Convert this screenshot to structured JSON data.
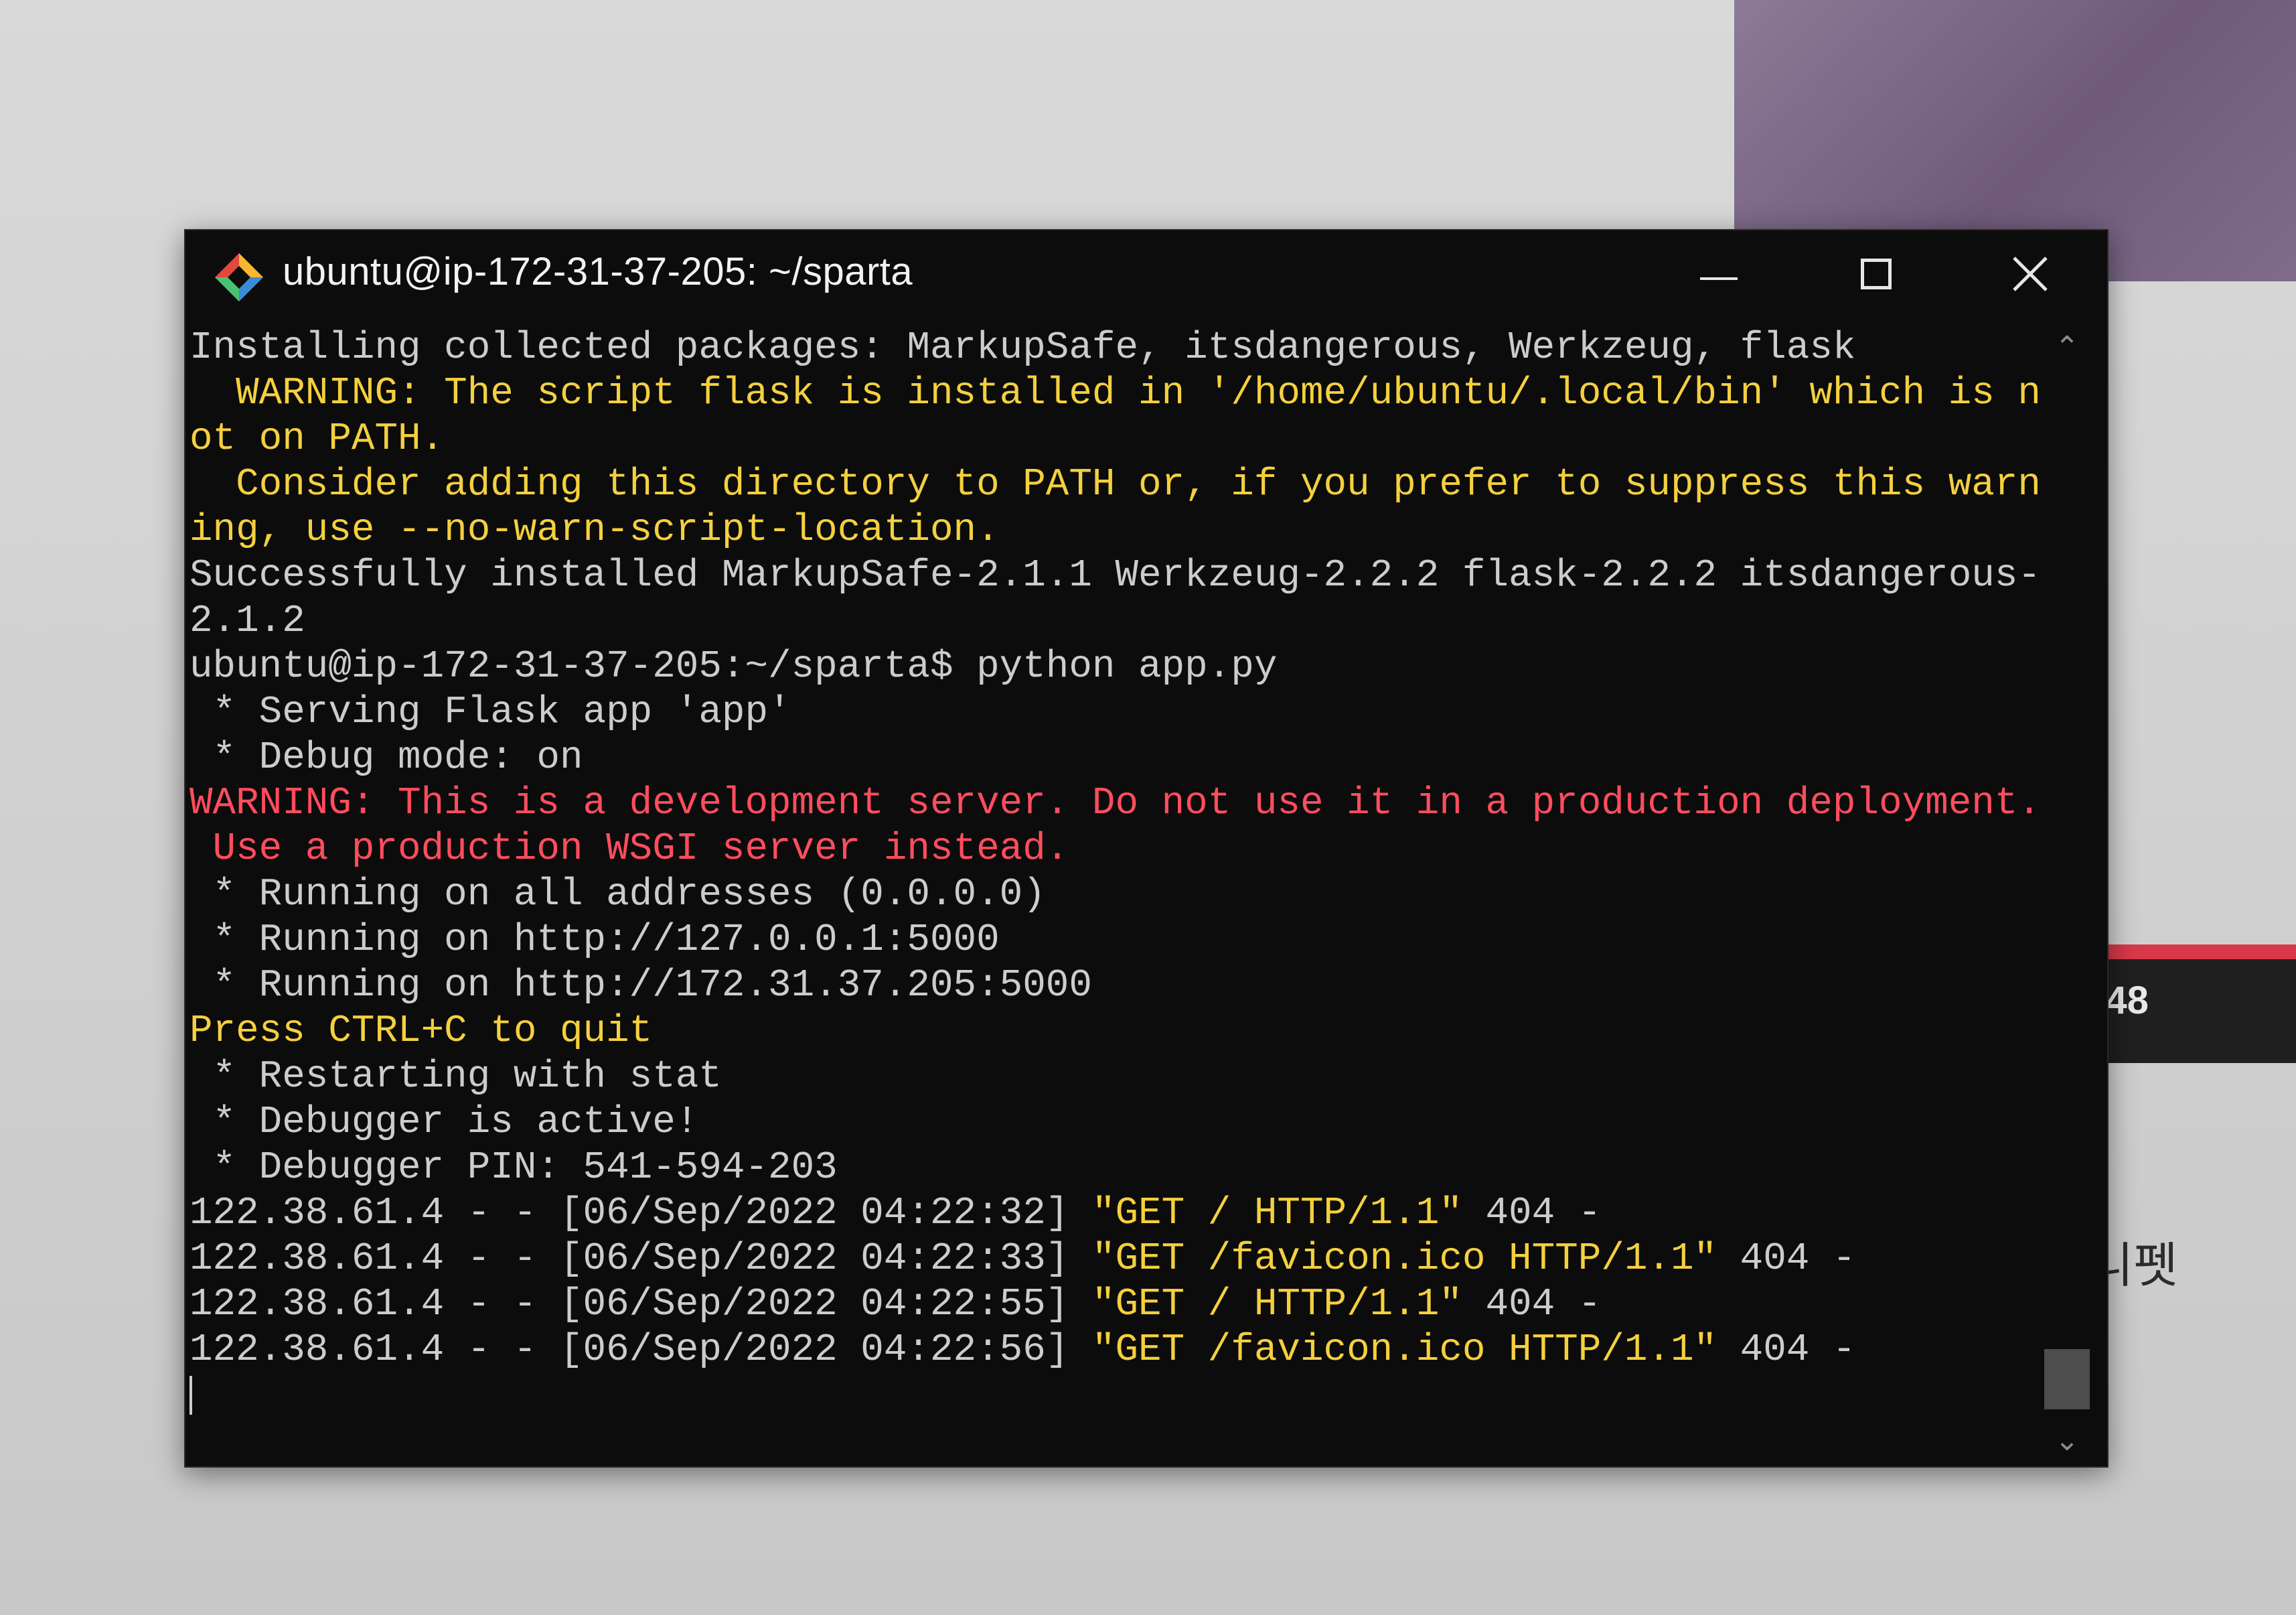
{
  "background": {
    "time_fragment": ":48",
    "korean_fragment": "니펫"
  },
  "window": {
    "title": "ubuntu@ip-172-31-37-205: ~/sparta",
    "controls": {
      "minimize": "minimize",
      "maximize": "maximize",
      "close": "close"
    }
  },
  "colors": {
    "text_default": "#cccccc",
    "text_warning": "#f4d03f",
    "text_error": "#ff4d5e",
    "background": "#0c0c0c"
  },
  "console": {
    "lines": [
      [
        {
          "t": "Installing collected packages: MarkupSafe, itsdangerous, Werkzeug, flask",
          "c": "w"
        }
      ],
      [
        {
          "t": "  WARNING: The script flask is installed in '/home/ubuntu/.local/bin' which is n",
          "c": "y"
        }
      ],
      [
        {
          "t": "ot on PATH.",
          "c": "y"
        }
      ],
      [
        {
          "t": "  Consider adding this directory to PATH or, if you prefer to suppress this warn",
          "c": "y"
        }
      ],
      [
        {
          "t": "ing, use --no-warn-script-location.",
          "c": "y"
        }
      ],
      [
        {
          "t": "Successfully installed MarkupSafe-2.1.1 Werkzeug-2.2.2 flask-2.2.2 itsdangerous-",
          "c": "w"
        }
      ],
      [
        {
          "t": "2.1.2",
          "c": "w"
        }
      ],
      [
        {
          "t": "ubuntu@ip-172-31-37-205:~/sparta$ python app.py",
          "c": "w"
        }
      ],
      [
        {
          "t": " * Serving Flask app 'app'",
          "c": "w"
        }
      ],
      [
        {
          "t": " * Debug mode: on",
          "c": "w"
        }
      ],
      [
        {
          "t": "WARNING: This is a development server. Do not use it in a production deployment.",
          "c": "r"
        }
      ],
      [
        {
          "t": " Use a production WSGI server instead.",
          "c": "r"
        }
      ],
      [
        {
          "t": " * Running on all addresses (0.0.0.0)",
          "c": "w"
        }
      ],
      [
        {
          "t": " * Running on http://127.0.0.1:5000",
          "c": "w"
        }
      ],
      [
        {
          "t": " * Running on http://172.31.37.205:5000",
          "c": "w"
        }
      ],
      [
        {
          "t": "Press CTRL+C to quit",
          "c": "y"
        }
      ],
      [
        {
          "t": " * Restarting with stat",
          "c": "w"
        }
      ],
      [
        {
          "t": " * Debugger is active!",
          "c": "w"
        }
      ],
      [
        {
          "t": " * Debugger PIN: 541-594-203",
          "c": "w"
        }
      ],
      [
        {
          "t": "122.38.61.4 - - [06/Sep/2022 04:22:32] ",
          "c": "w"
        },
        {
          "t": "\"GET / HTTP/1.1\"",
          "c": "y"
        },
        {
          "t": " 404 -",
          "c": "w"
        }
      ],
      [
        {
          "t": "122.38.61.4 - - [06/Sep/2022 04:22:33] ",
          "c": "w"
        },
        {
          "t": "\"GET /favicon.ico HTTP/1.1\"",
          "c": "y"
        },
        {
          "t": " 404 -",
          "c": "w"
        }
      ],
      [
        {
          "t": "122.38.61.4 - - [06/Sep/2022 04:22:55] ",
          "c": "w"
        },
        {
          "t": "\"GET / HTTP/1.1\"",
          "c": "y"
        },
        {
          "t": " 404 -",
          "c": "w"
        }
      ],
      [
        {
          "t": "122.38.61.4 - - [06/Sep/2022 04:22:56] ",
          "c": "w"
        },
        {
          "t": "\"GET /favicon.ico HTTP/1.1\"",
          "c": "y"
        },
        {
          "t": " 404 -",
          "c": "w"
        }
      ]
    ]
  },
  "scrollbar": {
    "up_icon": "chevron-up-icon",
    "down_icon": "chevron-down-icon",
    "position": 0.95
  }
}
